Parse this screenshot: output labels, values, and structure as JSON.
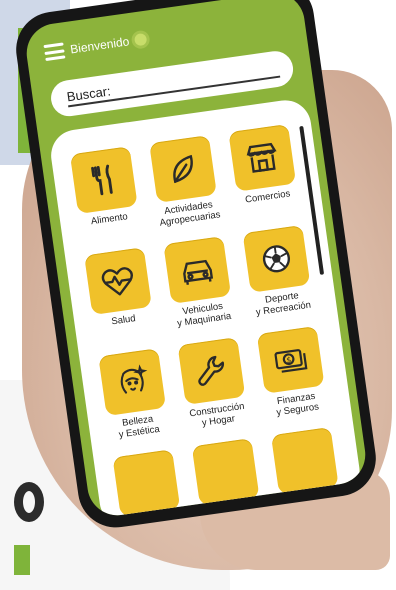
{
  "header": {
    "welcome": "Bienvenido",
    "menu_icon": "hamburger-menu-icon",
    "brand_icon": "sprout-icon"
  },
  "search": {
    "label": "Buscar:"
  },
  "categories": [
    {
      "label": "Alimento",
      "icon": "fork-knife-icon"
    },
    {
      "label": "Actividades\nAgropecuarias",
      "icon": "leaf-icon"
    },
    {
      "label": "Comercios",
      "icon": "store-icon"
    },
    {
      "label": "Salud",
      "icon": "heart-pulse-icon"
    },
    {
      "label": "Vehiculos\ny Maquinaria",
      "icon": "car-icon"
    },
    {
      "label": "Deporte\ny Recreación",
      "icon": "soccer-ball-icon"
    },
    {
      "label": "Belleza\ny Estética",
      "icon": "woman-face-icon"
    },
    {
      "label": "Construcción\ny Hogar",
      "icon": "wrench-icon"
    },
    {
      "label": "Finanzas\ny Seguros",
      "icon": "money-icon"
    },
    {
      "label": "",
      "icon": ""
    },
    {
      "label": "",
      "icon": ""
    },
    {
      "label": "",
      "icon": ""
    }
  ],
  "colors": {
    "app_green": "#8cb33b",
    "tile_yellow": "#f0c12a"
  }
}
